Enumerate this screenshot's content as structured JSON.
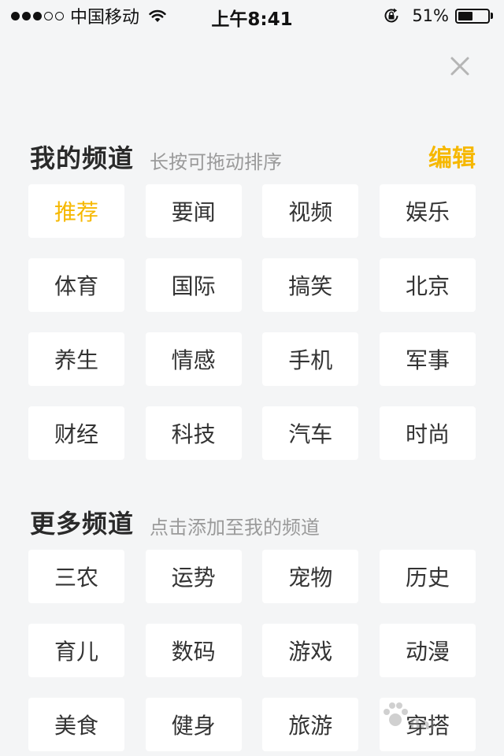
{
  "status_bar": {
    "carrier": "中国移动",
    "time": "上午8:41",
    "battery_percent_text": "51%",
    "battery_level": 0.51,
    "signal_bars_filled": 3,
    "signal_bars_total": 5
  },
  "close_icon": "close-icon",
  "my_channels": {
    "title": "我的频道",
    "hint": "长按可拖动排序",
    "edit_label": "编辑",
    "items": [
      "推荐",
      "要闻",
      "视频",
      "娱乐",
      "体育",
      "国际",
      "搞笑",
      "北京",
      "养生",
      "情感",
      "手机",
      "军事",
      "财经",
      "科技",
      "汽车",
      "时尚"
    ],
    "active_item": "推荐"
  },
  "more_channels": {
    "title": "更多频道",
    "hint": "点击添加至我的频道",
    "items": [
      "三农",
      "运势",
      "宠物",
      "历史",
      "育儿",
      "数码",
      "游戏",
      "动漫",
      "美食",
      "健身",
      "旅游",
      "穿搭"
    ]
  },
  "watermark": {
    "text": "Bai"
  },
  "colors": {
    "accent": "#f6b800",
    "background": "#f4f5f6",
    "chip": "#ffffff",
    "hint": "#9a9a9a"
  }
}
